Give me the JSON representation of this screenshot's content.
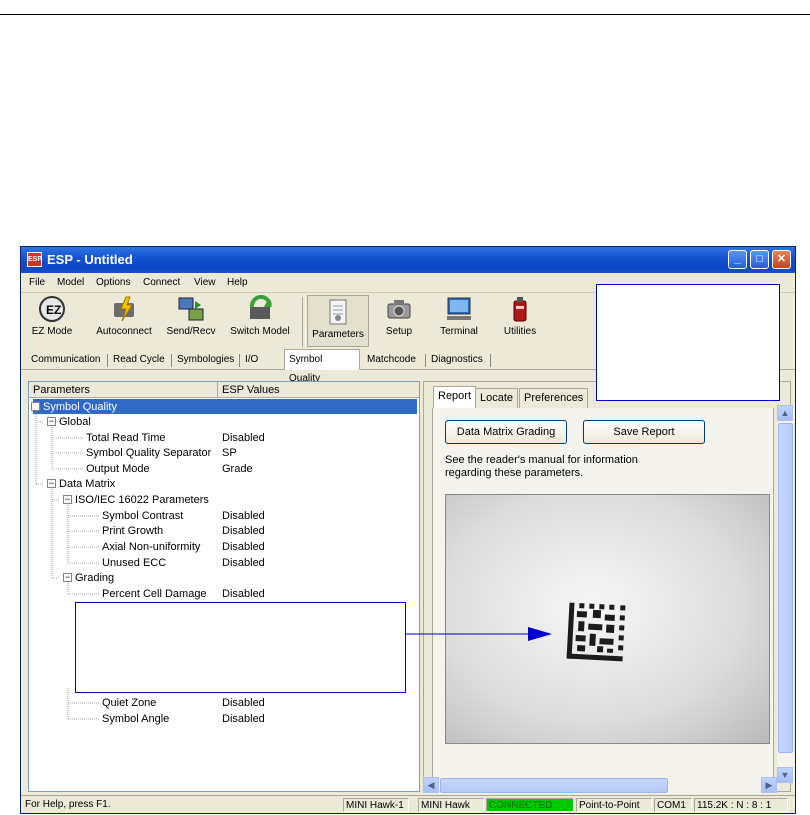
{
  "window": {
    "title": "ESP - Untitled",
    "icon_label": "ESP"
  },
  "menu": [
    "File",
    "Model",
    "Options",
    "Connect",
    "View",
    "Help"
  ],
  "toolbar": [
    {
      "label": "EZ Mode",
      "icon": "ez-mode-icon"
    },
    {
      "label": "Autoconnect",
      "icon": "autoconnect-icon"
    },
    {
      "label": "Send/Recv",
      "icon": "send-recv-icon"
    },
    {
      "label": "Switch Model",
      "icon": "switch-model-icon"
    },
    {
      "label": "Parameters",
      "icon": "parameters-icon"
    },
    {
      "label": "Setup",
      "icon": "setup-icon"
    },
    {
      "label": "Terminal",
      "icon": "terminal-icon"
    },
    {
      "label": "Utilities",
      "icon": "utilities-icon"
    }
  ],
  "tabs": [
    "Communication",
    "Read Cycle",
    "Symbologies",
    "I/O",
    "Symbol Quality",
    "Matchcode",
    "Diagnostics"
  ],
  "tree": {
    "col_params": "Parameters",
    "col_values": "ESP Values",
    "rows": [
      {
        "label": "Symbol Quality",
        "value": ""
      },
      {
        "label": "Global",
        "value": ""
      },
      {
        "label": "Total Read Time",
        "value": "Disabled"
      },
      {
        "label": "Symbol Quality Separator",
        "value": "SP"
      },
      {
        "label": "Output Mode",
        "value": "Grade"
      },
      {
        "label": "Data Matrix",
        "value": ""
      },
      {
        "label": "ISO/IEC 16022 Parameters",
        "value": ""
      },
      {
        "label": "Symbol Contrast",
        "value": "Disabled"
      },
      {
        "label": "Print Growth",
        "value": "Disabled"
      },
      {
        "label": "Axial Non-uniformity",
        "value": "Disabled"
      },
      {
        "label": "Unused ECC",
        "value": "Disabled"
      },
      {
        "label": "Grading",
        "value": ""
      },
      {
        "label": "Percent Cell Damage",
        "value": "Disabled"
      },
      {
        "label": "Quiet Zone",
        "value": "Disabled"
      },
      {
        "label": "Symbol Angle",
        "value": "Disabled"
      }
    ]
  },
  "right": {
    "tabs": [
      "Report",
      "Locate",
      "Preferences"
    ],
    "grading_button": "Data Matrix Grading",
    "save_button": "Save Report",
    "info_line1": "See the reader's manual for information",
    "info_line2": "regarding these parameters."
  },
  "status": {
    "help": "For Help, press F1.",
    "model1": "MINI Hawk-1",
    "model2": "MINI Hawk",
    "connected": "CONNECTED",
    "mode": "Point-to-Point",
    "port": "COM1",
    "settings": "115.2K : N : 8 : 1"
  },
  "colors": {
    "titlebar": "#0d46c4",
    "connected": "#00c800",
    "selection": "#316ac5",
    "callout": "#0000cc"
  }
}
